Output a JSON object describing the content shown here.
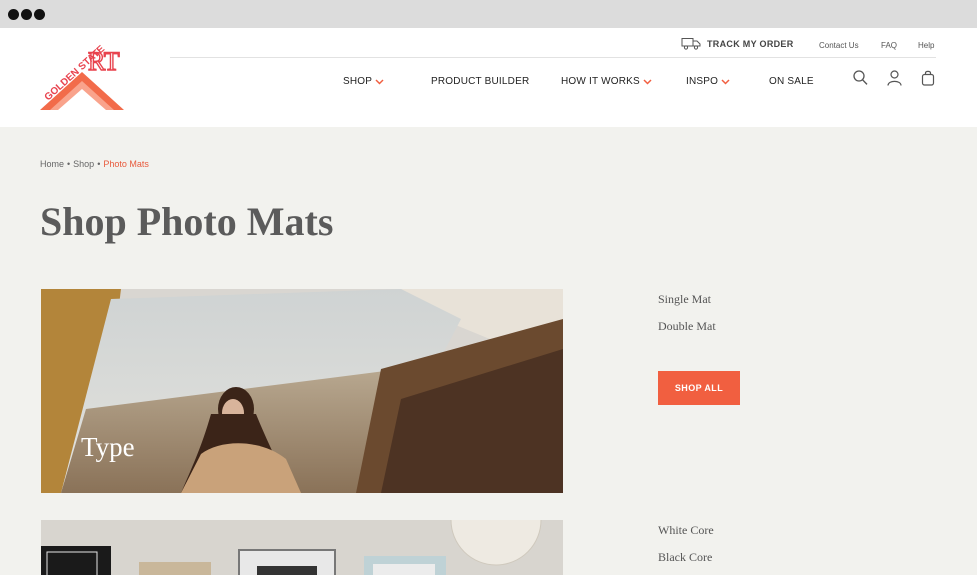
{
  "brand": {
    "logo_text_line1": "GOLDEN STATE",
    "logo_text_line2": "RT",
    "accent_color": "#f15f40"
  },
  "utility": {
    "track_label": "TRACK MY ORDER",
    "contact_label": "Contact Us",
    "faq_label": "FAQ",
    "help_label": "Help"
  },
  "nav": {
    "items": [
      {
        "label": "SHOP",
        "has_dropdown": true
      },
      {
        "label": "PRODUCT BUILDER",
        "has_dropdown": false
      },
      {
        "label": "HOW IT WORKS",
        "has_dropdown": true
      },
      {
        "label": "INSPO",
        "has_dropdown": true
      },
      {
        "label": "ON SALE",
        "has_dropdown": false
      }
    ],
    "icons": [
      "search-icon",
      "account-icon",
      "cart-icon"
    ]
  },
  "breadcrumb": {
    "items": [
      "Home",
      "Shop",
      "Photo Mats"
    ],
    "separator": "•"
  },
  "page": {
    "title": "Shop Photo Mats"
  },
  "sections": [
    {
      "card_label": "Type",
      "options": [
        "Single Mat",
        "Double Mat"
      ],
      "button_label": "SHOP ALL"
    },
    {
      "card_label": "",
      "options": [
        "White Core",
        "Black Core"
      ]
    }
  ]
}
